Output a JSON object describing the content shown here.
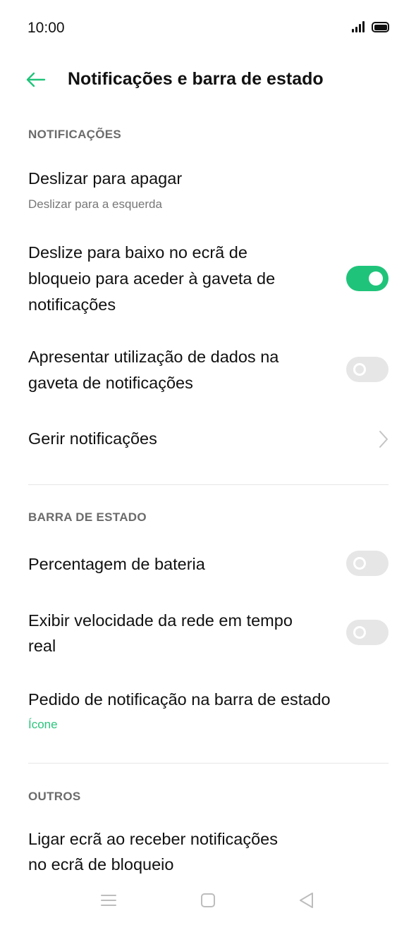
{
  "status": {
    "time": "10:00"
  },
  "header": {
    "title": "Notificações e barra de estado"
  },
  "sections": {
    "notifications": {
      "label": "NOTIFICAÇÕES",
      "swipe_delete": {
        "title": "Deslizar para apagar",
        "value": "Deslizar para a esquerda"
      },
      "lockscreen_swipe": {
        "line1": "Deslize para baixo no ecrã de",
        "line2": "bloqueio para aceder à gaveta de",
        "line3": "notificações",
        "enabled": true
      },
      "data_usage": {
        "line1": "Apresentar utilização de dados na",
        "line2": "gaveta de notificações",
        "enabled": false
      },
      "manage": {
        "title": "Gerir notificações"
      }
    },
    "status_bar": {
      "label": "BARRA DE ESTADO",
      "battery_percent": {
        "title": "Percentagem de bateria",
        "enabled": false
      },
      "network_speed": {
        "line1": "Exibir velocidade da rede em tempo",
        "line2": "real",
        "enabled": false
      },
      "notification_request": {
        "title": "Pedido de notificação na barra de estado",
        "value": "Ícone"
      }
    },
    "others": {
      "label": "OUTROS",
      "wake_screen": {
        "line1": "Ligar ecrã ao receber notificações",
        "line2": "no ecrã de bloqueio"
      }
    }
  },
  "colors": {
    "accent": "#1fc47a",
    "toggle_off": "#e6e6e6",
    "section_label": "#6b6b6b"
  }
}
